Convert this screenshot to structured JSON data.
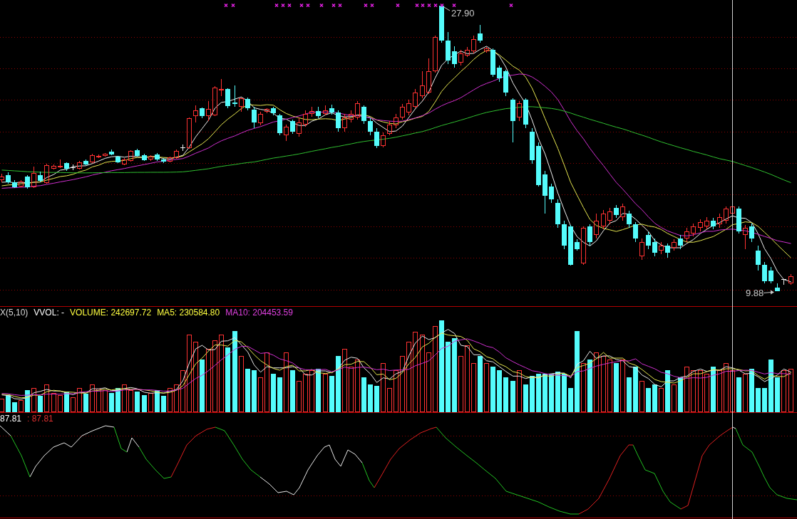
{
  "price_pane": {
    "high_label": "27.90",
    "low_label": "9.88"
  },
  "volume_pane": {
    "legend": [
      {
        "text": "X(5,10)",
        "color": "#d8d8d8"
      },
      {
        "text": "VVOL: -",
        "color": "#ffffff"
      },
      {
        "text": "VOLUME: 242697.72",
        "color": "#ffff40"
      },
      {
        "text": "MA5: 230584.80",
        "color": "#ffff40"
      },
      {
        "text": "MA10: 204453.59",
        "color": "#e040e0"
      }
    ]
  },
  "indicator_pane": {
    "legend": [
      {
        "text": "87.81",
        "color": "#ffffff"
      },
      {
        "text": ": 87.81",
        "color": "#e03030"
      }
    ]
  }
}
